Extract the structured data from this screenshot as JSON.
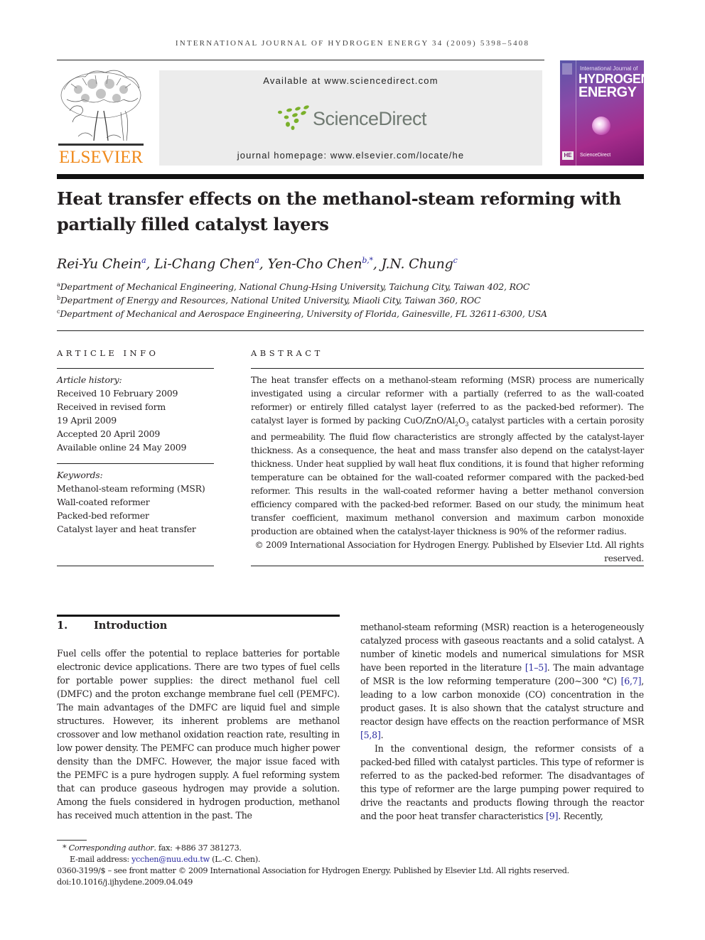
{
  "header": {
    "running_head": "International Journal of Hydrogen Energy 34 (2009) 5398–5408",
    "publisher_wordmark": "ELSEVIER",
    "available_at": "Available at www.sciencedirect.com",
    "sciencedirect_logo_text": "ScienceDirect",
    "journal_homepage": "journal homepage: www.elsevier.com/locate/he",
    "cover": {
      "line1": "International Journal of",
      "line2": "HYDROGEN",
      "line3": "ENERGY",
      "publisher_badge": "HE",
      "sd_label": "ScienceDirect"
    },
    "colors": {
      "elsevier_orange": "#f08a1c",
      "sciencedirect_green": "#7ab02a",
      "sciencedirect_gray": "#707a72",
      "link_blue": "#2a2aa0"
    }
  },
  "article": {
    "title": "Heat transfer effects on the methanol-steam reforming with partially filled catalyst layers",
    "authors": [
      {
        "name": "Rei-Yu Chein",
        "sup": "a"
      },
      {
        "name": "Li-Chang Chen",
        "sup": "a"
      },
      {
        "name": "Yen-Cho Chen",
        "sup": "b,*"
      },
      {
        "name": "J.N. Chung",
        "sup": "c"
      }
    ],
    "affiliations": [
      {
        "sup": "a",
        "text": "Department of Mechanical Engineering, National Chung-Hsing University, Taichung City, Taiwan 402, ROC"
      },
      {
        "sup": "b",
        "text": "Department of Energy and Resources, National United University, Miaoli City, Taiwan 360, ROC"
      },
      {
        "sup": "c",
        "text": "Department of Mechanical and Aerospace Engineering, University of Florida, Gainesville, FL 32611-6300, USA"
      }
    ]
  },
  "article_info": {
    "heading": "ARTICLE INFO",
    "history_label": "Article history:",
    "history": [
      "Received 10 February 2009",
      "Received in revised form",
      "19 April 2009",
      "Accepted 20 April 2009",
      "Available online 24 May 2009"
    ],
    "keywords_label": "Keywords:",
    "keywords": [
      "Methanol-steam reforming (MSR)",
      "Wall-coated reformer",
      "Packed-bed reformer",
      "Catalyst layer and heat transfer"
    ]
  },
  "abstract": {
    "heading": "ABSTRACT",
    "text_part1": "The heat transfer effects on a methanol-steam reforming (MSR) process are numerically investigated using a circular reformer with a partially (referred to as the wall-coated reformer) or entirely filled catalyst layer (referred to as the packed-bed reformer). The catalyst layer is formed by packing CuO/ZnO/Al",
    "sub1": "2",
    "text_part2": "O",
    "sub2": "3",
    "text_part3": " catalyst particles with a certain porosity and permeability. The fluid flow characteristics are strongly affected by the catalyst-layer thickness. As a consequence, the heat and mass transfer also depend on the catalyst-layer thickness. Under heat supplied by wall heat flux conditions, it is found that higher reforming temperature can be obtained for the wall-coated reformer compared with the packed-bed reformer. This results in the wall-coated reformer having a better methanol conversion efficiency compared with the packed-bed reformer. Based on our study, the minimum heat transfer coefficient, maximum methanol conversion and maximum carbon monoxide production are obtained when the catalyst-layer thickness is 90% of the reformer radius.",
    "copyright": "© 2009 International Association for Hydrogen Energy. Published by Elsevier Ltd. All rights reserved."
  },
  "introduction": {
    "number": "1.",
    "heading": "Introduction",
    "left_col": "Fuel cells offer the potential to replace batteries for portable electronic device applications. There are two types of fuel cells for portable power supplies: the direct methanol fuel cell (DMFC) and the proton exchange membrane fuel cell (PEMFC). The main advantages of the DMFC are liquid fuel and simple structures. However, its inherent problems are methanol crossover and low methanol oxidation reaction rate, resulting in low power density. The PEMFC can produce much higher power density than the DMFC. However, the major issue faced with the PEMFC is a pure hydrogen supply. A fuel reforming system that can produce gaseous hydrogen may provide a solution. Among the fuels considered in hydrogen production, methanol has received much attention in the past. The",
    "right_p1_a": "methanol-steam reforming (MSR) reaction is a heterogeneously catalyzed process with gaseous reactants and a solid catalyst. A number of kinetic models and numerical simulations for MSR have been reported in the literature ",
    "ref1": "[1–5]",
    "right_p1_b": ". The main advantage of MSR is the low reforming temperature (200∼300 °C) ",
    "ref2": "[6,7]",
    "right_p1_c": ", leading to a low carbon monoxide (CO) concentration in the product gases. It is also shown that the catalyst structure and reactor design have effects on the reaction performance of MSR ",
    "ref3": "[5,8]",
    "right_p1_d": ".",
    "right_p2_a": "In the conventional design, the reformer consists of a packed-bed filled with catalyst particles. This type of reformer is referred to as the packed-bed reformer. The disadvantages of this type of reformer are the large pumping power required to drive the reactants and products flowing through the reactor and the poor heat transfer characteristics ",
    "ref4": "[9]",
    "right_p2_b": ". Recently,"
  },
  "footnotes": {
    "star": "*",
    "corresponding_label": "Corresponding author",
    "fax": ". fax: +886 37 381273.",
    "email_label": "E-mail address: ",
    "email": "ycchen@nuu.edu.tw",
    "email_suffix": " (L.-C. Chen).",
    "front_matter": "0360-3199/$ – see front matter © 2009 International Association for Hydrogen Energy. Published by Elsevier Ltd. All rights reserved.",
    "doi": "doi:10.1016/j.ijhydene.2009.04.049"
  }
}
